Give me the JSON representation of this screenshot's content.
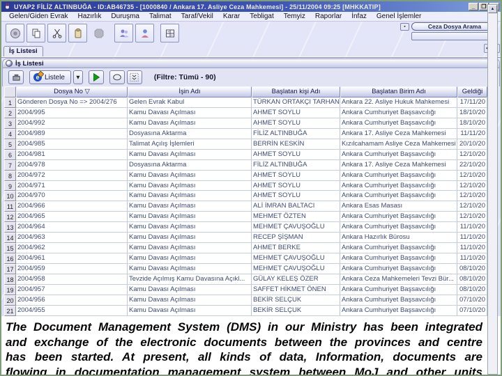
{
  "window": {
    "title": "UYAP2  FİLİZ ALTINBUĞA - ID:AB46735 - [1000840 / Ankara 17. Asliye Ceza Mahkemesi] - 25/11/2004 09:25 [MHKKATIP]",
    "controls": {
      "minimize": "_",
      "maximize": "❐",
      "close": "×"
    },
    "border_color": "#7f9e78"
  },
  "menu": {
    "items": [
      "Gelen/Giden Evrak",
      "Hazırlık",
      "Duruşma",
      "Talimat",
      "Taraf/Vekil",
      "Karar",
      "Tebligat",
      "Temyiz",
      "Raporlar",
      "İnfaz",
      "Genel İşlemler"
    ]
  },
  "toolbar": {
    "icons": [
      "info-icon",
      "copy-icon",
      "cut-icon",
      "paste-icon",
      "stop-icon",
      "users-icon",
      "user-icon",
      "calculator-icon"
    ],
    "ceza_button_label": "Ceza Dosya Arama",
    "combo_value": ""
  },
  "tab_strip": {
    "active_tab": "İş Listesi",
    "left_arrow": "<",
    "right_arrow": ">"
  },
  "panel": {
    "title": "İş Listesi",
    "toolbar": {
      "listele_label": "Listele",
      "dropdown_arrow": "▾",
      "filter_text": "(Filtre: Tümü - 90)",
      "icons": [
        "criteria-icon",
        "listele-e-icon",
        "play-icon",
        "oval-icon",
        "double-chevron-icon"
      ]
    }
  },
  "table": {
    "columns": [
      {
        "label": "Dosya No",
        "sort": "▽"
      },
      {
        "label": "İşin Adı",
        "sort": ""
      },
      {
        "label": "Başlatan kişi Adı",
        "sort": ""
      },
      {
        "label": "Başlatan Birim Adı",
        "sort": ""
      },
      {
        "label": "Geldiği",
        "sort": ""
      }
    ],
    "rows": [
      [
        "Gönderen Dosya No => 2004/276",
        "Gelen Evrak Kabul",
        "TÜRKAN ORTAKÇI TARHAN",
        "Ankara 22. Asliye Hukuk Mahkemesi",
        "17/11/20"
      ],
      [
        "2004/995",
        "Kamu Davası Açılması",
        "AHMET SOYLU",
        "Ankara Cumhuriyet Başsavcılığı",
        "18/10/20"
      ],
      [
        "2004/992",
        "Kamu Davası Açılması",
        "AHMET SOYLU",
        "Ankara Cumhuriyet Başsavcılığı",
        "18/10/20"
      ],
      [
        "2004/989",
        "Dosyasına Aktarma",
        "FİLİZ ALTINBUĞA",
        "Ankara 17. Asliye Ceza Mahkemesi",
        "11/11/20"
      ],
      [
        "2004/985",
        "Talimat Açılış İşlemleri",
        "BERRİN KESKİN",
        "Kızılcahamam Asliye Ceza Mahkemesi",
        "20/10/20"
      ],
      [
        "2004/981",
        "Kamu Davası Açılması",
        "AHMET SOYLU",
        "Ankara Cumhuriyet Başsavcılığı",
        "12/10/20"
      ],
      [
        "2004/978",
        "Dosyasına Aktarma",
        "FİLİZ ALTINBUĞA",
        "Ankara 17. Asliye Ceza Mahkemesi",
        "22/10/20"
      ],
      [
        "2004/972",
        "Kamu Davası Açılması",
        "AHMET SOYLU",
        "Ankara Cumhuriyet Başsavcılığı",
        "12/10/20"
      ],
      [
        "2004/971",
        "Kamu Davası Açılması",
        "AHMET SOYLU",
        "Ankara Cumhuriyet Başsavcılığı",
        "12/10/20"
      ],
      [
        "2004/970",
        "Kamu Davası Açılması",
        "AHMET SOYLU",
        "Ankara Cumhuriyet Başsavcılığı",
        "12/10/20"
      ],
      [
        "2004/966",
        "Kamu Davası Açılması",
        "ALİ İMRAN BALTACI",
        "Ankara Esas Masası",
        "12/10/20"
      ],
      [
        "2004/965",
        "Kamu Davası Açılması",
        "MEHMET ÖZTEN",
        "Ankara Cumhuriyet Başsavcılığı",
        "12/10/20"
      ],
      [
        "2004/964",
        "Kamu Davası Açılması",
        "MEHMET ÇAVUŞOĞLU",
        "Ankara Cumhuriyet Başsavcılığı",
        "11/10/20"
      ],
      [
        "2004/963",
        "Kamu Davası Açılması",
        "RECEP ŞİŞMAN",
        "Ankara Hazırlık Bürosu",
        "11/10/20"
      ],
      [
        "2004/962",
        "Kamu Davası Açılması",
        "AHMET BERKE",
        "Ankara Cumhuriyet Başsavcılığı",
        "11/10/20"
      ],
      [
        "2004/961",
        "Kamu Davası Açılması",
        "MEHMET ÇAVUŞOĞLU",
        "Ankara Cumhuriyet Başsavcılığı",
        "11/10/20"
      ],
      [
        "2004/959",
        "Kamu Davası Açılması",
        "MEHMET ÇAVUŞOĞLU",
        "Ankara Cumhuriyet Başsavcılığı",
        "08/10/20"
      ],
      [
        "2004/958",
        "Tevzide Açılmış Kamu Davasına Açıkl...",
        "GÜLAY KELEŞ ÖZER",
        "Ankara Ceza Mahkemeleri Tevzi Bür...",
        "08/10/20"
      ],
      [
        "2004/957",
        "Kamu Davası Açılması",
        "SAFFET HİKMET ÖNEN",
        "Ankara Cumhuriyet Başsavcılığı",
        "08/10/20"
      ],
      [
        "2004/956",
        "Kamu Davası Açılması",
        "BEKİR SELÇUK",
        "Ankara Cumhuriyet Başsavcılığı",
        "07/10/20"
      ],
      [
        "2004/955",
        "Kamu Davası Açılması",
        "BEKİR SELÇUK",
        "Ankara Cumhuriyet Başsavcılığı",
        "07/10/20"
      ]
    ]
  },
  "caption": {
    "lines": [
      "The Document Management System (DMS) in our Ministry has been integrated",
      "and exchange of the electronic documents between the provinces and centre",
      "has been started. At present, all kinds of data, Information, documents are",
      "flowing in documentation management system between MoJ and other units"
    ]
  },
  "colors": {
    "titlebar_start": "#2c3a98",
    "titlebar_end": "#7d9eda",
    "background": "#dfe1f5",
    "table_header": "#c2c7e6",
    "play_green": "#119c11",
    "window_border_green": "#7f9e78"
  }
}
